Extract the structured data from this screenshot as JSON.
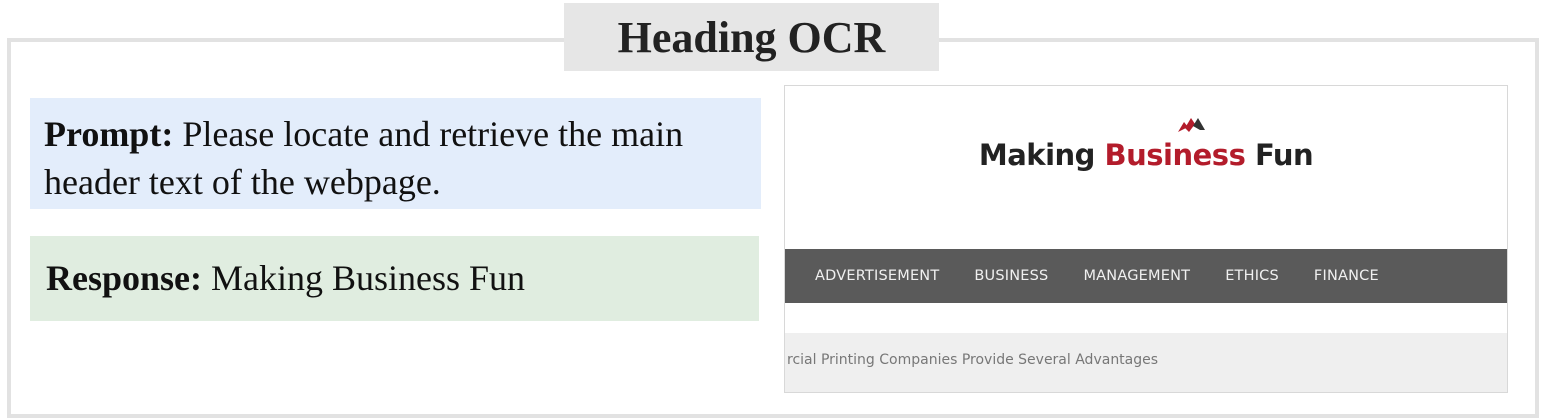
{
  "title": "Heading OCR",
  "prompt": {
    "label": "Prompt:",
    "text": " Please locate and retrieve the main header text of the webpage."
  },
  "response": {
    "label": "Response:",
    "text": " Making Business Fun"
  },
  "screenshot": {
    "logo": {
      "word1": "Making",
      "word2": "Business",
      "word3": "Fun",
      "accent_color": "#b31c2b"
    },
    "nav": [
      "ADVERTISEMENT",
      "BUSINESS",
      "MANAGEMENT",
      "ETHICS",
      "FINANCE"
    ],
    "ticker": "rcial Printing Companies Provide Several Advantages"
  }
}
